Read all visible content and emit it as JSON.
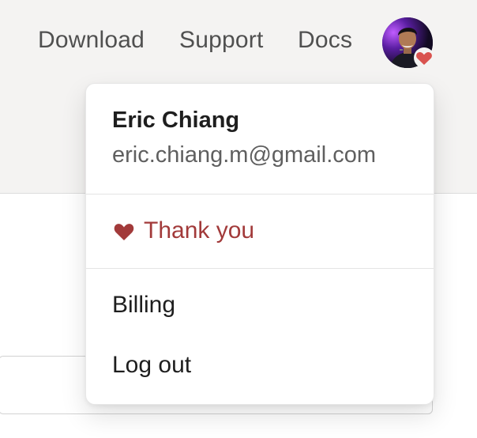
{
  "nav": {
    "download": "Download",
    "support": "Support",
    "docs": "Docs"
  },
  "avatar": {
    "icon": "user-avatar",
    "badge_icon": "heart-icon"
  },
  "dropdown": {
    "user_name": "Eric Chiang",
    "user_email": "eric.chiang.m@gmail.com",
    "thank_you_label": "Thank you",
    "billing_label": "Billing",
    "logout_label": "Log out"
  },
  "colors": {
    "accent_heart": "#a23a3a",
    "badge_heart": "#d9534f",
    "page_background": "#f4f3f2"
  }
}
